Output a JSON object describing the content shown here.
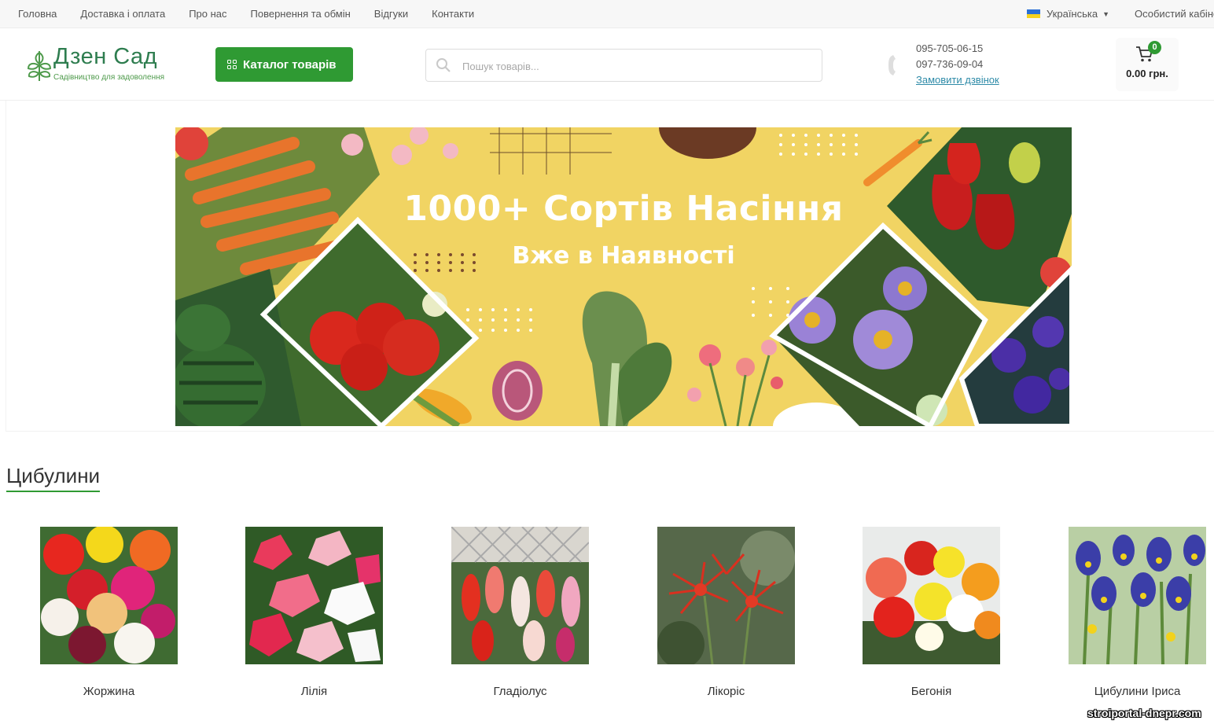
{
  "topnav": {
    "items": [
      "Головна",
      "Доставка і оплата",
      "Про нас",
      "Повернення та обмін",
      "Відгуки",
      "Контакти"
    ],
    "language": "Українська",
    "account": "Особистий кабінет"
  },
  "header": {
    "logo_title": "Дзен Сад",
    "logo_subtitle": "Садівництво для задоволення",
    "catalog_button": "Каталог товарів",
    "search_placeholder": "Пошук товарів...",
    "phones": [
      "095-705-06-15",
      "097-736-09-04"
    ],
    "callback_link": "Замовити дзвінок",
    "cart_count": "0",
    "cart_total": "0.00 грн."
  },
  "banner": {
    "title": "1000+ Сортів Насіння",
    "subtitle": "Вже в Наявності"
  },
  "section": {
    "title": "Цибулини",
    "categories": [
      {
        "name": "Жоржина"
      },
      {
        "name": "Лілія"
      },
      {
        "name": "Гладіолус"
      },
      {
        "name": "Лікоріс"
      },
      {
        "name": "Бегонія"
      },
      {
        "name": "Цибулини Іриса"
      }
    ]
  },
  "watermark": "stroiportal-dnepr.com",
  "colors": {
    "accent_green": "#2f9a33",
    "banner_yellow": "#f1d463",
    "link_blue": "#2e8ba8"
  },
  "icons": [
    "search-icon",
    "phone-icon",
    "cart-icon",
    "grid-icon",
    "chevron-down-icon",
    "ukraine-flag-icon"
  ]
}
